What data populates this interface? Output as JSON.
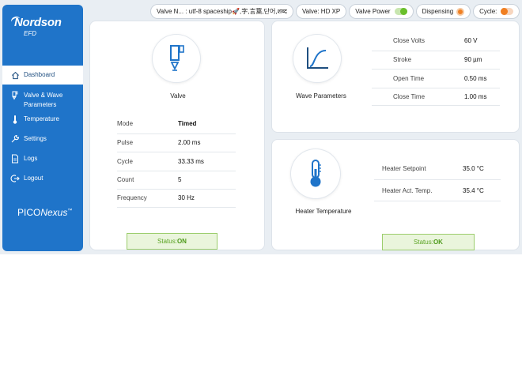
{
  "sidebar": {
    "brand": "Nordson",
    "brand_sub": "EFD",
    "items": [
      {
        "label": "Dashboard",
        "icon": "home-icon"
      },
      {
        "label": "Valve & Wave Parameters",
        "icon": "valve-icon"
      },
      {
        "label": "Temperature",
        "icon": "thermometer-icon"
      },
      {
        "label": "Settings",
        "icon": "wrench-icon"
      },
      {
        "label": "Logs",
        "icon": "document-icon"
      },
      {
        "label": "Logout",
        "icon": "logout-icon"
      }
    ],
    "product_prefix": "PICO",
    "product_suffix": "Nexus",
    "product_tm": "™"
  },
  "topbar": {
    "valve_name": "Valve N... :  utf-8 spaceship🚀,字,言葉,단어,शब्द",
    "valve_model": "Valve:  HD XP",
    "valve_power": "Valve Power",
    "dispensing": "Dispensing",
    "cycle": "Cycle:"
  },
  "valve": {
    "title": "Valve",
    "rows": [
      {
        "k": "Mode",
        "v": "Timed"
      },
      {
        "k": "Pulse",
        "v": "2.00 ms"
      },
      {
        "k": "Cycle",
        "v": "33.33 ms"
      },
      {
        "k": "Count",
        "v": "5"
      },
      {
        "k": "Frequency",
        "v": "30 Hz"
      }
    ],
    "status_label": "Status:",
    "status_value": "ON"
  },
  "wave": {
    "title": "Wave Parameters",
    "rows": [
      {
        "k": "Close Volts",
        "v": "60 V"
      },
      {
        "k": "Stroke",
        "v": "90 µm"
      },
      {
        "k": "Open Time",
        "v": "0.50 ms"
      },
      {
        "k": "Close Time",
        "v": "1.00 ms"
      }
    ]
  },
  "heater": {
    "title": "Heater Temperature",
    "rows": [
      {
        "k": "Heater Setpoint",
        "v": "35.0 °C"
      },
      {
        "k": "Heater Act. Temp.",
        "v": "35.4 °C"
      }
    ],
    "status_label": "Status:",
    "status_value": "OK"
  },
  "colors": {
    "primary": "#1f74c9",
    "ok_green": "#6abf2c",
    "warn_orange": "#f07f22"
  }
}
